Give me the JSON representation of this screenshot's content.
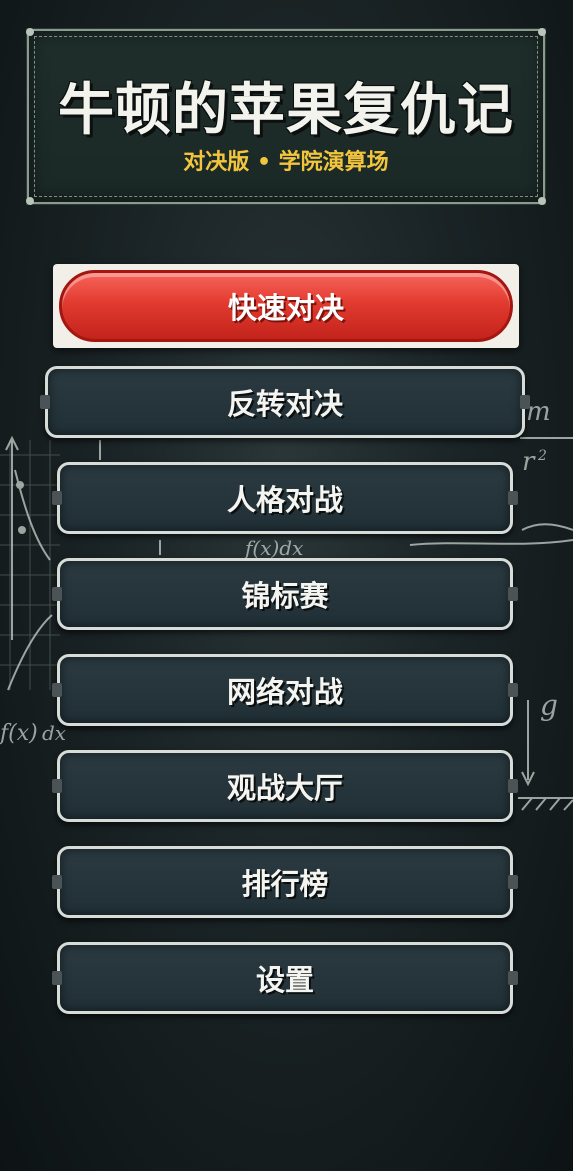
{
  "title": {
    "main": "牛顿的苹果复仇记",
    "subtitle": "对决版 • 学院演算场"
  },
  "menu": {
    "items": [
      {
        "label": "快速对决",
        "style": "primary"
      },
      {
        "label": "反转对决",
        "style": "chalk"
      },
      {
        "label": "人格对战",
        "style": "chalk"
      },
      {
        "label": "锦标赛",
        "style": "chalk"
      },
      {
        "label": "网络对战",
        "style": "chalk"
      },
      {
        "label": "观战大厅",
        "style": "chalk"
      },
      {
        "label": "排行榜",
        "style": "chalk"
      },
      {
        "label": "设置",
        "style": "chalk"
      }
    ]
  },
  "colors": {
    "subtitle": "#f2c53d",
    "primary_button": "#e23b30",
    "chalk_button": "#203036",
    "board": "#1a2826"
  }
}
